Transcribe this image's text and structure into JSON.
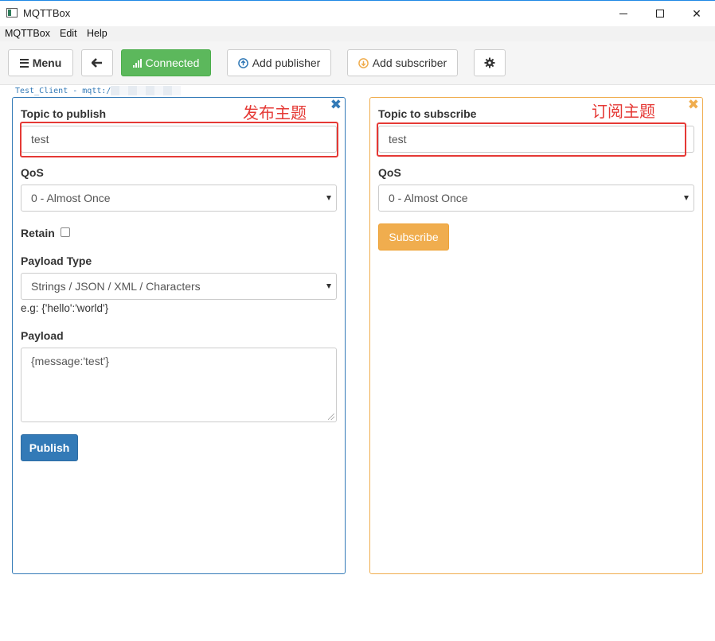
{
  "window": {
    "title": "MQTTBox",
    "close_glyph": "✕"
  },
  "menubar": {
    "items": [
      "MQTTBox",
      "Edit",
      "Help"
    ]
  },
  "toolbar": {
    "menu_label": "Menu",
    "connected_label": "Connected",
    "add_publisher_label": "Add publisher",
    "add_subscriber_label": "Add subscriber",
    "icons": {
      "menu": "bars-icon",
      "back": "arrow-left-icon",
      "connected": "signal-icon",
      "add_publisher": "arrow-circle-up-icon",
      "add_subscriber": "arrow-circle-down-icon",
      "settings": "gear-icon"
    },
    "connected_color": "#5cb85c"
  },
  "client": {
    "label": "Test_Client - mqtt:/"
  },
  "publisher": {
    "close_glyph": "✖",
    "topic_label": "Topic to publish",
    "topic_value": "test",
    "qos_label": "QoS",
    "qos_value": "0 - Almost Once",
    "retain_label": "Retain",
    "retain_checked": false,
    "payload_type_label": "Payload Type",
    "payload_type_value": "Strings / JSON / XML / Characters",
    "payload_hint": "e.g: {'hello':'world'}",
    "payload_label": "Payload",
    "payload_value": "{message:'test'}",
    "publish_label": "Publish",
    "accent_color": "#337ab7"
  },
  "subscriber": {
    "close_glyph": "✖",
    "topic_label": "Topic to subscribe",
    "topic_value": "test",
    "qos_label": "QoS",
    "qos_value": "0 - Almost Once",
    "subscribe_label": "Subscribe",
    "accent_color": "#f0ad4e"
  },
  "annotations": {
    "publish_topic_note": "发布主题",
    "subscribe_topic_note": "订阅主题",
    "color": "#e53935"
  }
}
